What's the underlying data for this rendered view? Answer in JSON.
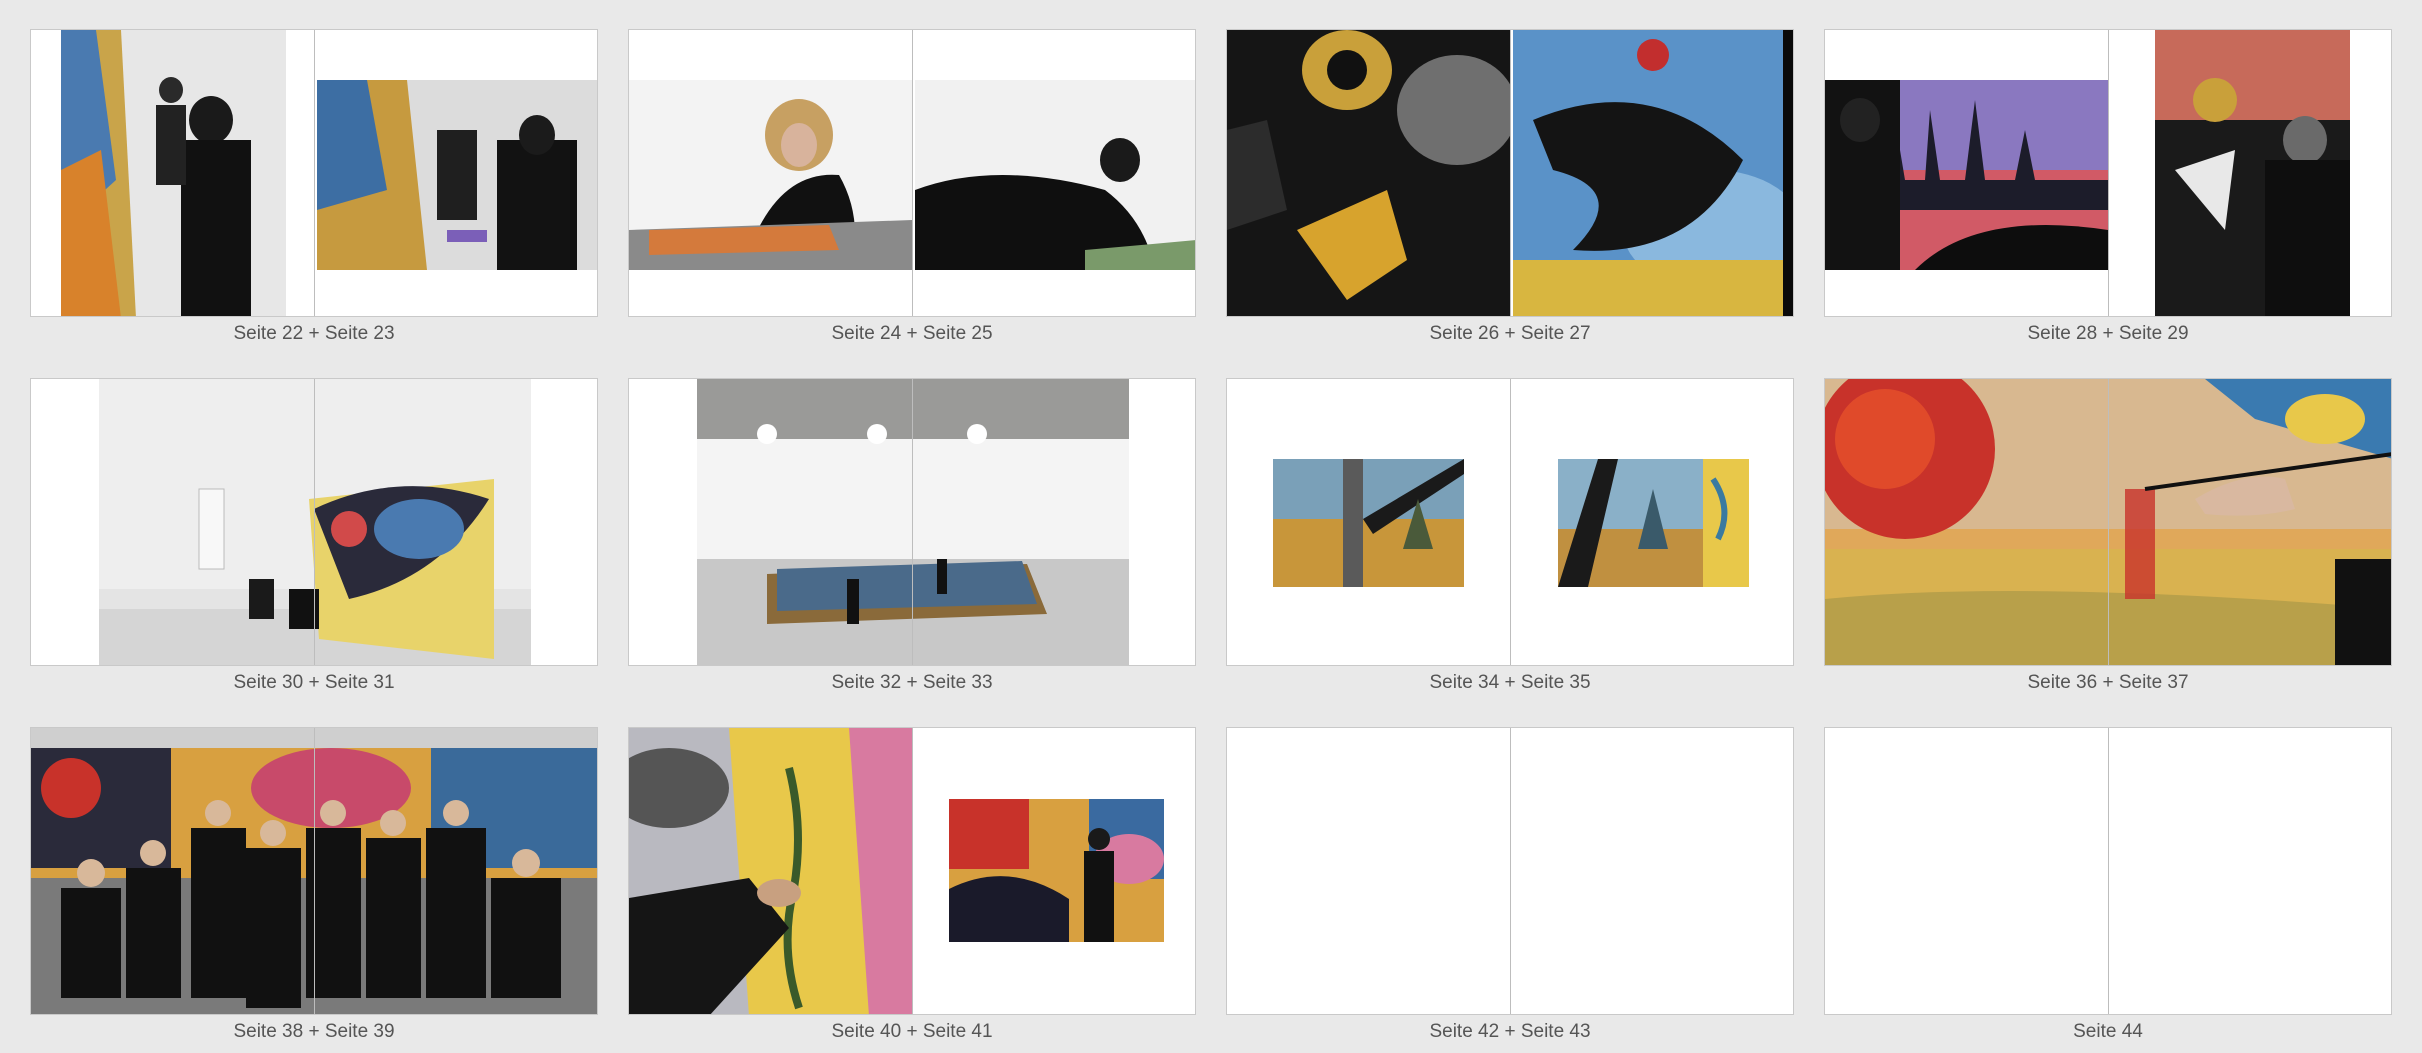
{
  "spreads": [
    {
      "label": "Seite 22 + Seite 23",
      "left_photo": "painter-at-canvas-photo",
      "right_photo": "painters-at-wall-photo"
    },
    {
      "label": "Seite 24 + Seite 25",
      "left_photo": "curly-artist-painting-photo",
      "right_photo": "artist-kneeling-photo"
    },
    {
      "label": "Seite 26 + Seite 27",
      "left_photo": "painting-closeup-photo",
      "right_photo": "dragon-mural-photo"
    },
    {
      "label": "Seite 28 + Seite 29",
      "left_photo": "skyline-mural-photo",
      "right_photo": "artist-detail-photo"
    },
    {
      "label": "Seite 30 + Seite 31",
      "photo": "studio-dragon-canvas-photo"
    },
    {
      "label": "Seite 32 + Seite 33",
      "photo": "studio-hall-overview-photo"
    },
    {
      "label": "Seite 34 + Seite 35",
      "left_photo": "desert-painting-small-photo",
      "right_photo": "desert-painting-small-photo-2"
    },
    {
      "label": "Seite 36 + Seite 37",
      "photo": "sunset-painting-brush-photo"
    },
    {
      "label": "Seite 38 + Seite 39",
      "photo": "group-portrait-photo"
    },
    {
      "label": "Seite 40 + Seite 41",
      "left_photo": "tree-painting-hand-photo",
      "right_photo": "artist-at-mural-photo"
    },
    {
      "label": "Seite 42 + Seite 43"
    },
    {
      "label": "Seite 44"
    }
  ]
}
